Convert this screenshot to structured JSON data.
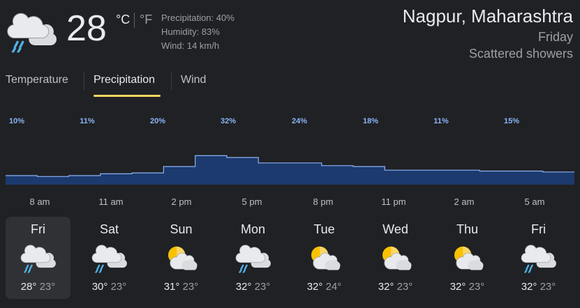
{
  "current": {
    "icon": "rain-cloud-icon",
    "temperature": "28",
    "unit_c": "°C",
    "unit_f": "°F",
    "precipitation": "Precipitation: 40%",
    "humidity": "Humidity: 83%",
    "wind": "Wind: 14 km/h"
  },
  "location": {
    "title": "Nagpur, Maharashtra",
    "day": "Friday",
    "condition": "Scattered showers"
  },
  "tabs": [
    {
      "label": "Temperature",
      "active": false
    },
    {
      "label": "Precipitation",
      "active": true
    },
    {
      "label": "Wind",
      "active": false
    }
  ],
  "colors": {
    "background": "#202124",
    "accent_underline": "#fdd663",
    "bar_fill": "#1c3a6e",
    "bar_line": "#8ab4f8",
    "label_blue": "#8ab4f8"
  },
  "chart_data": {
    "type": "area",
    "title": "",
    "xlabel": "",
    "ylabel": "",
    "ylim": [
      0,
      100
    ],
    "unit": "%",
    "x": [
      "8 am",
      "11 am",
      "2 pm",
      "5 pm",
      "8 pm",
      "11 pm",
      "2 am",
      "5 am"
    ],
    "values": [
      10,
      11,
      20,
      32,
      24,
      18,
      11,
      15
    ],
    "values_labels": [
      "10%",
      "11%",
      "20%",
      "32%",
      "24%",
      "18%",
      "11%",
      "15%"
    ],
    "step_values": [
      10,
      9,
      10,
      12,
      13,
      20,
      32,
      30,
      24,
      24,
      21,
      20,
      16,
      16,
      16,
      15,
      15,
      14
    ]
  },
  "forecast": [
    {
      "day": "Fri",
      "icon": "rain-cloud-icon",
      "high": "28°",
      "low": "23°",
      "selected": true
    },
    {
      "day": "Sat",
      "icon": "rain-cloud-icon",
      "high": "30°",
      "low": "23°",
      "selected": false
    },
    {
      "day": "Sun",
      "icon": "partly-cloudy-icon",
      "high": "31°",
      "low": "23°",
      "selected": false
    },
    {
      "day": "Mon",
      "icon": "rain-cloud-icon",
      "high": "32°",
      "low": "23°",
      "selected": false
    },
    {
      "day": "Tue",
      "icon": "partly-cloudy-icon",
      "high": "32°",
      "low": "24°",
      "selected": false
    },
    {
      "day": "Wed",
      "icon": "partly-cloudy-icon",
      "high": "32°",
      "low": "23°",
      "selected": false
    },
    {
      "day": "Thu",
      "icon": "partly-cloudy-icon",
      "high": "32°",
      "low": "23°",
      "selected": false
    },
    {
      "day": "Fri",
      "icon": "rain-cloud-icon",
      "high": "32°",
      "low": "23°",
      "selected": false
    }
  ]
}
